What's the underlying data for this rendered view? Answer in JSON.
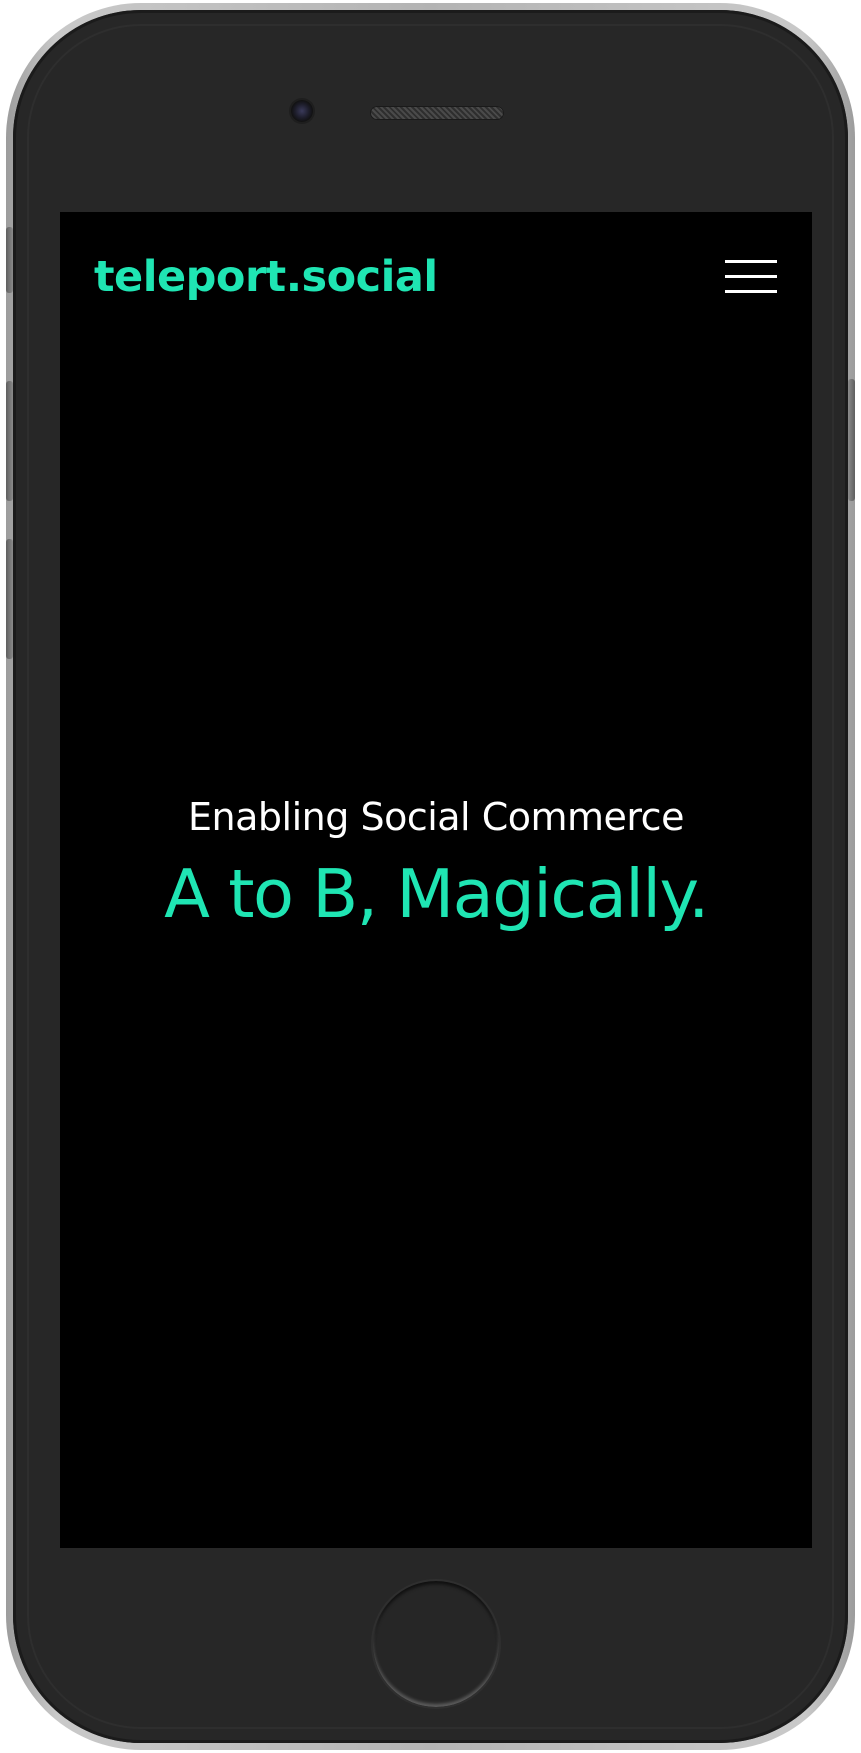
{
  "site": {
    "logo_text": "teleport.social",
    "menu_icon": "hamburger-menu-icon"
  },
  "hero": {
    "subtitle": "Enabling Social Commerce",
    "title": "A to B, Magically."
  },
  "colors": {
    "accent": "#1fe5b3",
    "background": "#000000",
    "text": "#ffffff",
    "device_body": "#272727"
  }
}
